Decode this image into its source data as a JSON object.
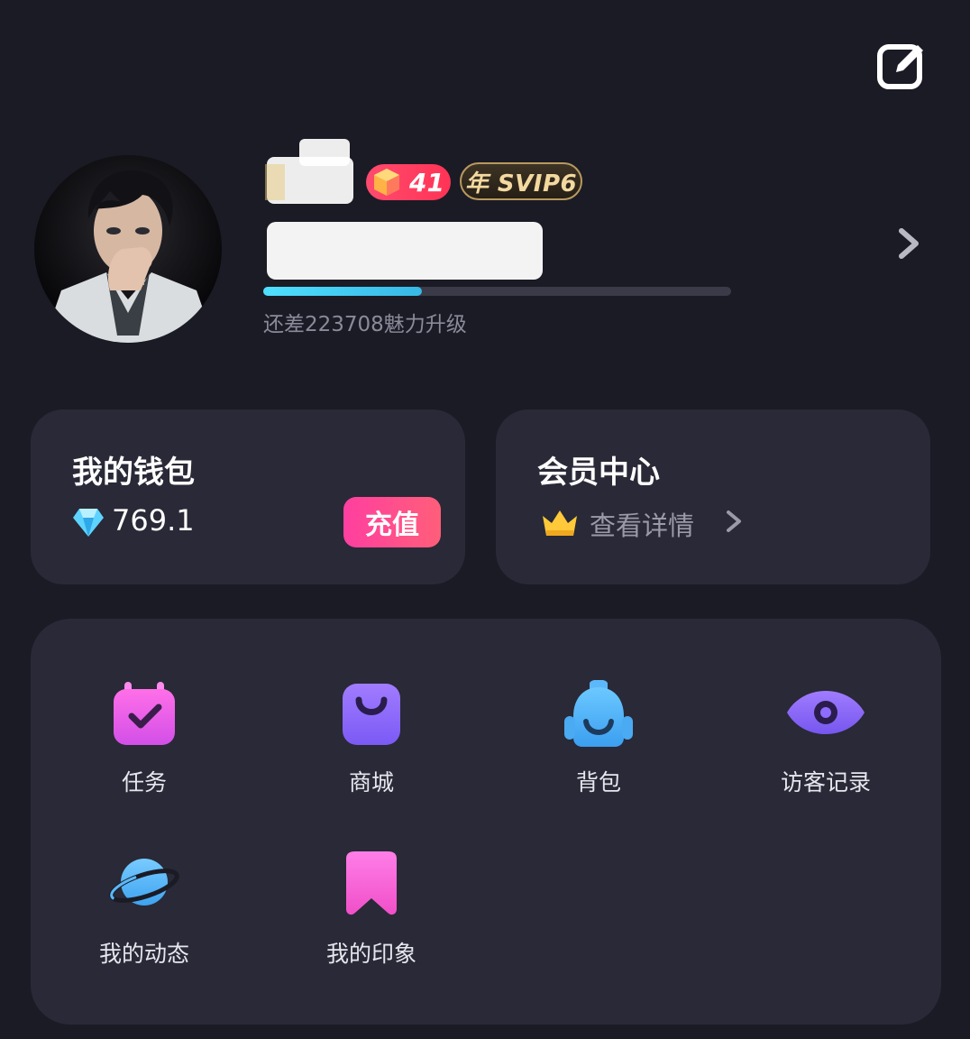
{
  "profile": {
    "level": "41",
    "vip_badge": "年 SVIP6",
    "charm_progress": 0.34,
    "charm_text": "还差223708魅力升级"
  },
  "wallet": {
    "title": "我的钱包",
    "balance": "769.1",
    "recharge_label": "充值"
  },
  "vip_center": {
    "title": "会员中心",
    "detail_label": "查看详情"
  },
  "menu": {
    "items": [
      {
        "label": "任务",
        "icon": "calendar-check-icon",
        "color": "#f06ae0"
      },
      {
        "label": "商城",
        "icon": "shopping-bag-icon",
        "color": "#8f6bff"
      },
      {
        "label": "背包",
        "icon": "backpack-icon",
        "color": "#4ab2f5"
      },
      {
        "label": "访客记录",
        "icon": "eye-icon",
        "color": "#8e6cff"
      },
      {
        "label": "我的动态",
        "icon": "planet-icon",
        "color": "#54b8f6"
      },
      {
        "label": "我的印象",
        "icon": "bookmark-icon",
        "color": "#f56ad0"
      }
    ]
  },
  "colors": {
    "background": "#1b1b26",
    "card": "#292937",
    "accent_pink": "#ff3fa0",
    "progress": "#4fe0ff"
  }
}
